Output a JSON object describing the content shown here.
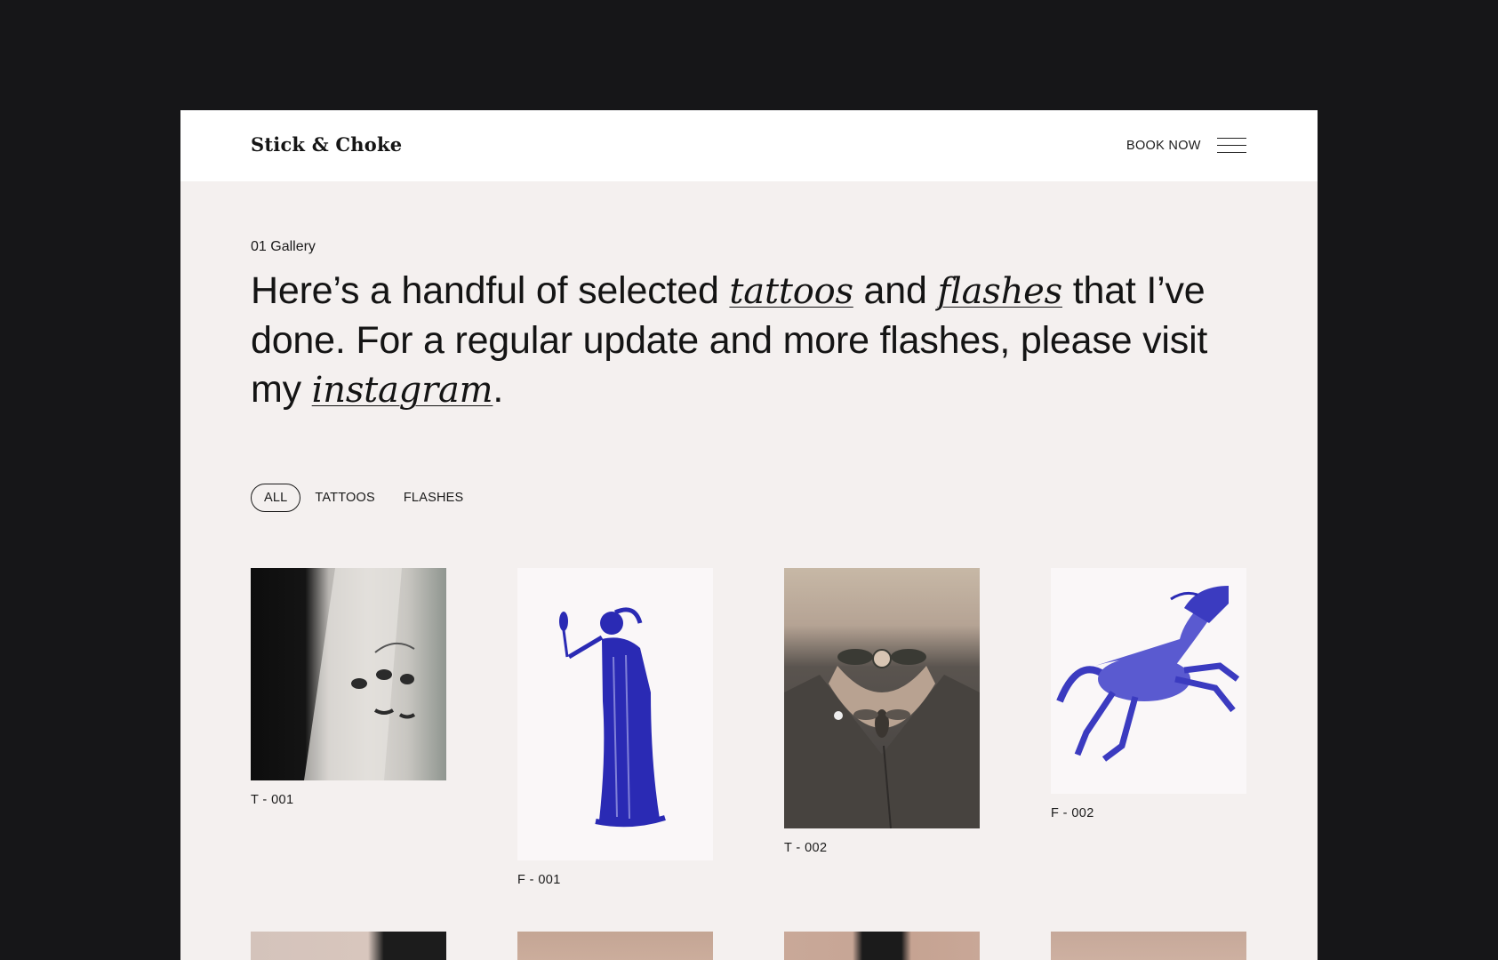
{
  "header": {
    "logo": "Stick & Choke",
    "book_now": "BOOK NOW",
    "menu_icon": "hamburger-menu-icon"
  },
  "intro": {
    "section_label": "01 Gallery",
    "headline": {
      "part1": "Here’s a handful of selected ",
      "link1": "tattoos",
      "part2": " and ",
      "link2": "flashes",
      "part3": " that I’ve done. For a regular update and more flashes, please visit my ",
      "link3": "instagram",
      "part4": "."
    }
  },
  "filters": [
    {
      "label": "ALL",
      "active": true
    },
    {
      "label": "TATTOOS",
      "active": false
    },
    {
      "label": "FLASHES",
      "active": false
    }
  ],
  "gallery": [
    {
      "caption": "T - 001",
      "subject": "forearm tattoo of faces photo"
    },
    {
      "caption": "F - 001",
      "subject": "blue flash of robed woman with mirror"
    },
    {
      "caption": "T - 002",
      "subject": "neck and chest tattoo of flowers and bee photo"
    },
    {
      "caption": "F - 002",
      "subject": "blue flash of rearing horse"
    }
  ],
  "colors": {
    "page_background": "#161618",
    "frame_background": "#f4f0ef",
    "header_background": "#ffffff",
    "text": "#141414",
    "flash_ink": "#2a2ab4"
  }
}
